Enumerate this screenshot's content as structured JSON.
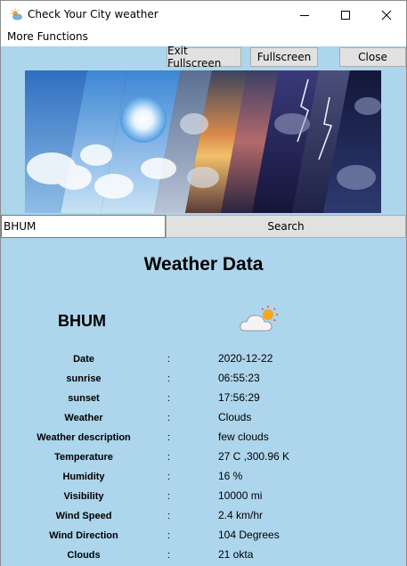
{
  "window": {
    "title": "Check Your City weather"
  },
  "menu": {
    "items": [
      "More Functions"
    ]
  },
  "toolbar": {
    "exit_fullscreen_label": "Exit Fullscreen",
    "fullscreen_label": "Fullscreen",
    "close_label": "Close"
  },
  "search": {
    "value": "BHUM",
    "button_label": "Search"
  },
  "main": {
    "heading": "Weather Data",
    "city": "BHUM",
    "weather_icon": "partly-cloudy-icon",
    "rows": [
      {
        "label": "Date",
        "value": "2020-12-22"
      },
      {
        "label": "sunrise",
        "value": "06:55:23"
      },
      {
        "label": "sunset",
        "value": "17:56:29"
      },
      {
        "label": "Weather",
        "value": "Clouds"
      },
      {
        "label": "Weather description",
        "value": "few clouds"
      },
      {
        "label": "Temperature",
        "value": "27 C ,300.96 K"
      },
      {
        "label": "Humidity",
        "value": "16 %"
      },
      {
        "label": "Visibility",
        "value": "10000 mi"
      },
      {
        "label": "Wind Speed",
        "value": "2.4 km/hr"
      },
      {
        "label": "Wind Direction",
        "value": "104 Degrees"
      },
      {
        "label": "Clouds",
        "value": "21 okta"
      }
    ],
    "separator": ":"
  },
  "colors": {
    "background": "#add5ec",
    "button": "#e1e1e1"
  }
}
